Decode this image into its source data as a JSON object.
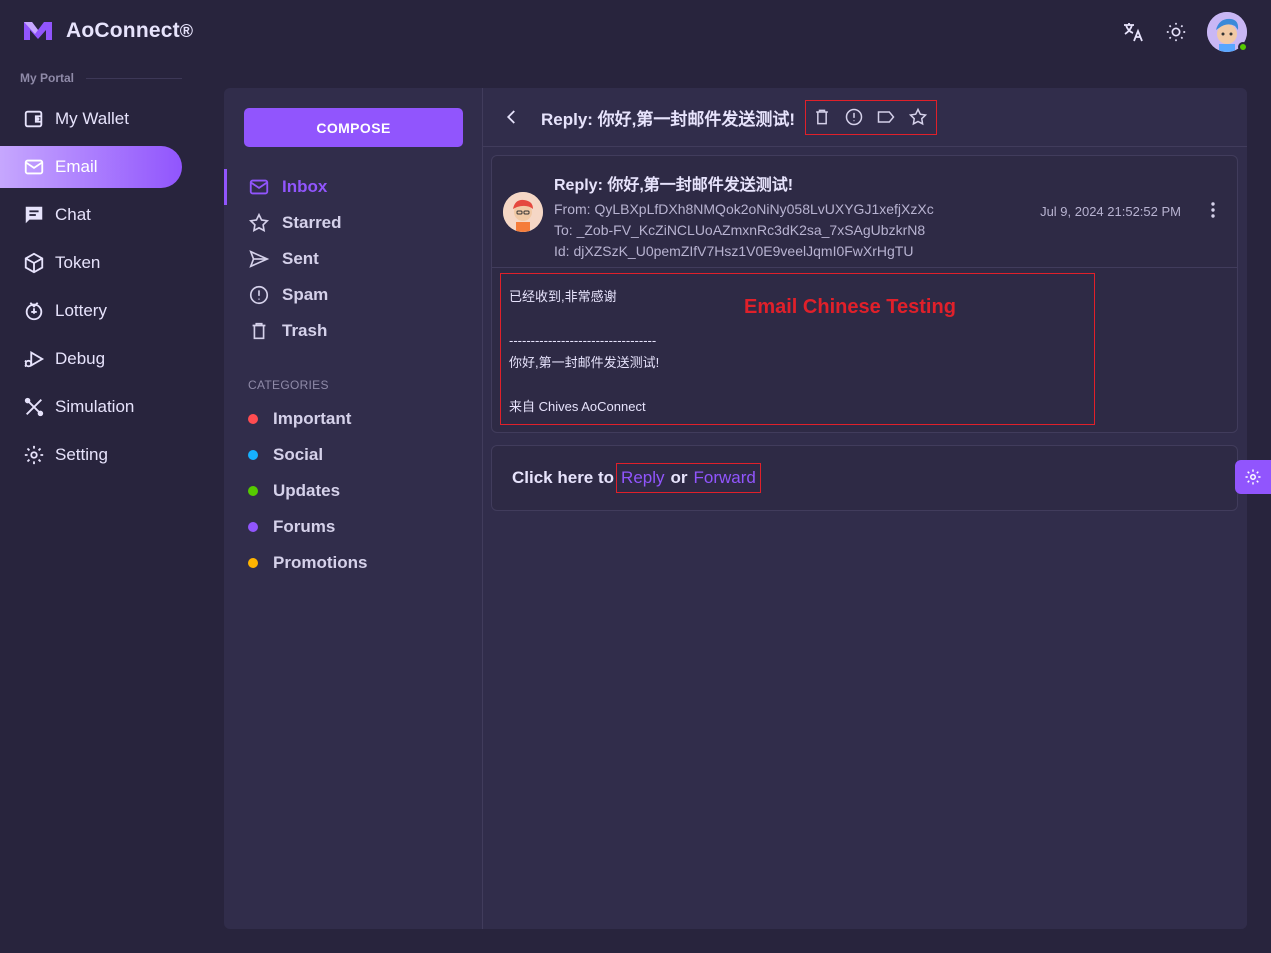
{
  "brand": {
    "name": "AoConnect",
    "mark": "®"
  },
  "sidebar": {
    "section_label": "My Portal",
    "items": [
      {
        "label": "My Wallet",
        "icon": "wallet-icon",
        "active": false
      },
      {
        "label": "Email",
        "icon": "mail-icon",
        "active": true
      },
      {
        "label": "Chat",
        "icon": "chat-icon",
        "active": false
      },
      {
        "label": "Token",
        "icon": "token-icon",
        "active": false
      },
      {
        "label": "Lottery",
        "icon": "lottery-icon",
        "active": false
      },
      {
        "label": "Debug",
        "icon": "debug-icon",
        "active": false
      },
      {
        "label": "Simulation",
        "icon": "simulation-icon",
        "active": false
      },
      {
        "label": "Setting",
        "icon": "gear-icon",
        "active": false
      }
    ]
  },
  "mail_nav": {
    "compose_label": "COMPOSE",
    "folders": [
      {
        "label": "Inbox",
        "active": true
      },
      {
        "label": "Starred"
      },
      {
        "label": "Sent"
      },
      {
        "label": "Spam"
      },
      {
        "label": "Trash"
      }
    ],
    "categories_label": "CATEGORIES",
    "categories": [
      {
        "label": "Important",
        "color": "#ff4c51"
      },
      {
        "label": "Social",
        "color": "#16b1ff"
      },
      {
        "label": "Updates",
        "color": "#56ca00"
      },
      {
        "label": "Forums",
        "color": "#9155fd"
      },
      {
        "label": "Promotions",
        "color": "#ffb400"
      }
    ]
  },
  "email": {
    "header_subject": "Reply: 你好,第一封邮件发送测试!",
    "subject": "Reply: 你好,第一封邮件发送测试!",
    "from": "From: QyLBXpLfDXh8NMQok2oNiNy058LvUXYGJ1xefjXzXc",
    "to": "To: _Zob-FV_KcZiNCLUoAZmxnRc3dK2sa_7xSAgUbzkrN8",
    "id": "Id: djXZSzK_U0pemZIfV7Hsz1V0E9veelJqmI0FwXrHgTU",
    "date": "Jul 9, 2024 21:52:52 PM",
    "body": {
      "line1": "已经收到,非常感谢",
      "separator": "----------------------------------",
      "line2": "你好,第一封邮件发送测试!",
      "signature": "来自 Chives AoConnect"
    },
    "annotation": "Email Chinese Testing"
  },
  "reply_bar": {
    "prefix": "Click here to",
    "reply": "Reply",
    "or": "or",
    "forward": "Forward"
  },
  "colors": {
    "accent": "#9155fd",
    "highlight_box": "#e0202a",
    "background": "#28243d",
    "card": "#312d4b"
  }
}
